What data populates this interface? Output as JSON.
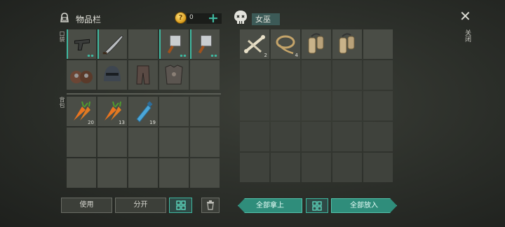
{
  "inventory": {
    "title": "物品栏",
    "pocket_label": "口袋",
    "backpack_label": "背包",
    "coins": "0",
    "pocket": [
      {
        "icon": "pistol-icon",
        "dots": true
      },
      {
        "icon": "machete-icon",
        "dots": false
      },
      {
        "icon": "",
        "dots": false
      },
      {
        "icon": "cleaver-icon",
        "dots": true
      },
      {
        "icon": "cleaver-icon",
        "dots": true
      },
      {
        "icon": "armor-boots-icon",
        "dots": false
      },
      {
        "icon": "helmet-icon",
        "dots": false
      },
      {
        "icon": "armor-pants-icon",
        "dots": false
      },
      {
        "icon": "chest-armor-icon",
        "dots": false
      },
      {
        "icon": "",
        "dots": false
      }
    ],
    "backpack": [
      {
        "icon": "carrot-icon",
        "qty": "20"
      },
      {
        "icon": "carrot-icon",
        "qty": "13"
      },
      {
        "icon": "water-bottle-icon",
        "qty": "19"
      },
      {
        "icon": "",
        "qty": ""
      },
      {
        "icon": "",
        "qty": ""
      },
      {
        "icon": "",
        "qty": ""
      },
      {
        "icon": "",
        "qty": ""
      },
      {
        "icon": "",
        "qty": ""
      },
      {
        "icon": "",
        "qty": ""
      },
      {
        "icon": "",
        "qty": ""
      },
      {
        "icon": "",
        "qty": ""
      },
      {
        "icon": "",
        "qty": ""
      },
      {
        "icon": "",
        "qty": ""
      },
      {
        "icon": "",
        "qty": ""
      },
      {
        "icon": "",
        "qty": ""
      }
    ]
  },
  "container": {
    "title": "女巫",
    "slots": [
      {
        "icon": "bones-icon",
        "qty": "2"
      },
      {
        "icon": "rope-icon",
        "qty": "4"
      },
      {
        "icon": "pouch-icon",
        "qty": ""
      },
      {
        "icon": "pouch-icon",
        "qty": ""
      },
      {
        "icon": "",
        "qty": ""
      }
    ]
  },
  "close_label": "关闭",
  "buttons": {
    "use": "使用",
    "split": "分开",
    "take_all": "全部拿上",
    "put_all": "全部放入"
  },
  "colors": {
    "accent": "#3fb8a0",
    "accent_button": "#2f8d7b",
    "slot": "#4a4d46"
  }
}
